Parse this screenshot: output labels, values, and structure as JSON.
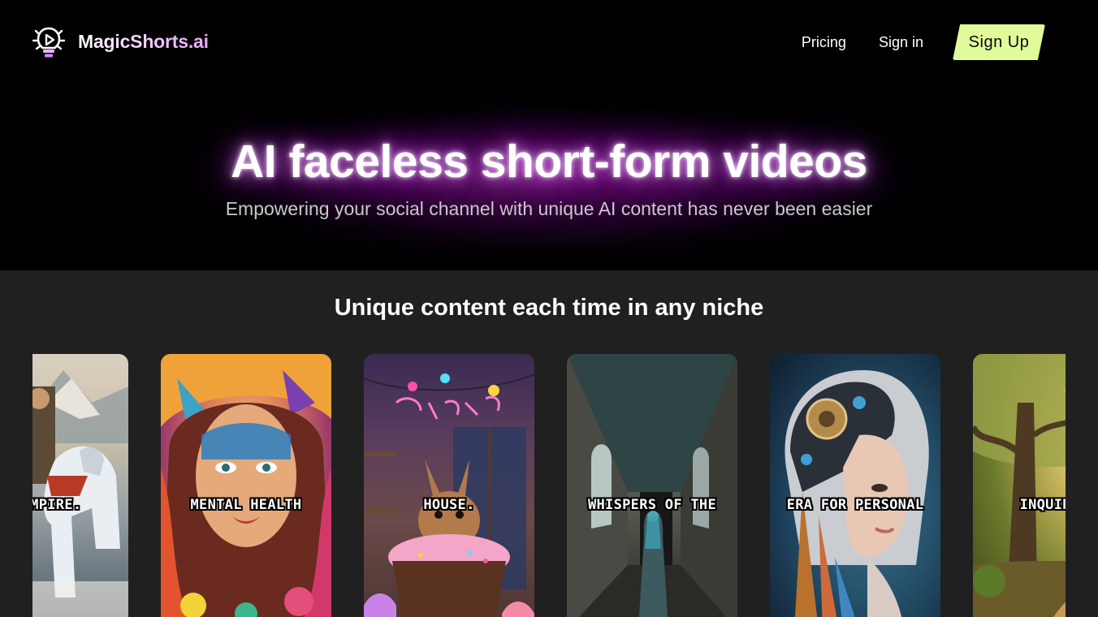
{
  "header": {
    "brand_name": "MagicShorts.ai",
    "nav": {
      "pricing": "Pricing",
      "sign_in": "Sign in",
      "sign_up": "Sign Up"
    }
  },
  "hero": {
    "title": "AI faceless short-form videos",
    "subtitle": "Empowering your social channel with unique AI content has never been easier"
  },
  "showcase": {
    "title": "Unique content each time in any niche",
    "cards": [
      {
        "caption": "L EMPIRE.",
        "icon": "warrior-on-horse-painting"
      },
      {
        "caption": "MENTAL HEALTH",
        "icon": "colorful-woman-portrait"
      },
      {
        "caption": "HOUSE.",
        "icon": "bunny-on-cupcake-neon-sign"
      },
      {
        "caption": "WHISPERS OF THE",
        "icon": "abandoned-hallway-woman"
      },
      {
        "caption": "ERA FOR PERSONAL",
        "icon": "robot-woman-head"
      },
      {
        "caption": "INQUIRIES",
        "icon": "sunlit-forest-path"
      }
    ]
  },
  "colors": {
    "page_background": "#000000",
    "section_background": "#202020",
    "signup_button": "#e2fb9a",
    "glow": "#c040e0"
  }
}
